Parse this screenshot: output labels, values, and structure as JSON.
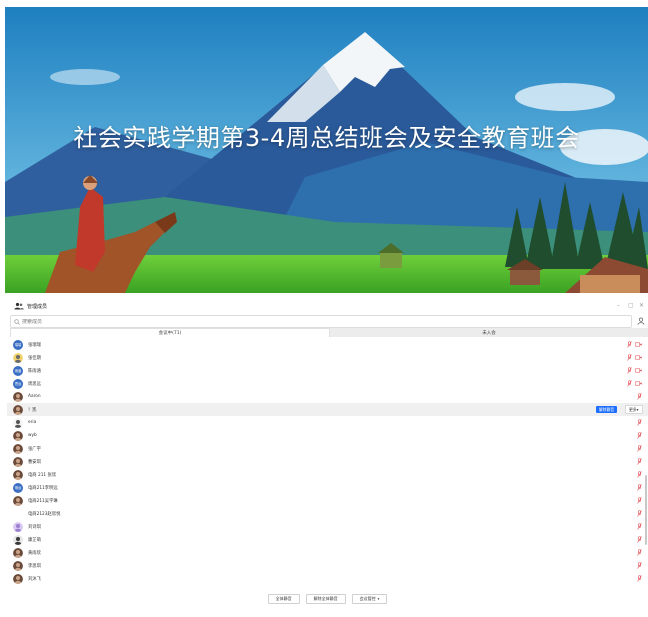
{
  "banner": {
    "title": "社会实践学期第3-4周总结班会及安全教育班会"
  },
  "window": {
    "title": "管理成员",
    "controls": [
      "–",
      "▢",
      "✕"
    ]
  },
  "search": {
    "placeholder": "搜索成员"
  },
  "tabs": [
    {
      "label": "会议中(71)",
      "active": true
    },
    {
      "label": "未入会",
      "active": false
    }
  ],
  "members": [
    {
      "name": "张瑞瑞",
      "avatar_text": "瑞瑞",
      "avatar_color": "#3a6fc4",
      "camera": true
    },
    {
      "name": "张佳期",
      "avatar_icon": "anime-avatar",
      "camera": true
    },
    {
      "name": "陈雨涵",
      "avatar_text": "雨涵",
      "avatar_color": "#3a6fc4",
      "camera": true
    },
    {
      "name": "周思远",
      "avatar_text": "思远",
      "avatar_color": "#3a6fc4",
      "camera": true
    },
    {
      "name": "Aaron",
      "avatar_icon": "photo-avatar",
      "camera": false
    },
    {
      "name": "！凯",
      "avatar_icon": "photo-avatar",
      "camera": false,
      "highlighted": true
    },
    {
      "name": "eria",
      "avatar_icon": "sketch-avatar",
      "camera": false
    },
    {
      "name": "wyb",
      "avatar_icon": "photo-avatar",
      "camera": false
    },
    {
      "name": "张广宇",
      "avatar_icon": "photo-avatar",
      "camera": false
    },
    {
      "name": "曹安琪",
      "avatar_icon": "photo-avatar",
      "camera": false
    },
    {
      "name": "电商 211 张欣",
      "avatar_icon": "photo-avatar",
      "camera": false
    },
    {
      "name": "电商211李明远",
      "avatar_text": "明远",
      "avatar_color": "#3a6fc4",
      "camera": false
    },
    {
      "name": "电商211吴宇琳",
      "avatar_icon": "photo-avatar",
      "camera": false
    },
    {
      "name": "电商2123赵欣悦",
      "avatar_icon": "none",
      "camera": false
    },
    {
      "name": "刘诗琪",
      "avatar_icon": "pastel-avatar",
      "camera": false
    },
    {
      "name": "康芷萌",
      "avatar_icon": "cartoon-avatar",
      "camera": false
    },
    {
      "name": "黄雨欣",
      "avatar_icon": "photo-avatar",
      "camera": false
    },
    {
      "name": "李思琪",
      "avatar_icon": "photo-avatar",
      "camera": false
    },
    {
      "name": "刘沐飞",
      "avatar_icon": "photo-avatar",
      "camera": false
    }
  ],
  "row_actions": {
    "unmute": "解除静音",
    "more": "更多"
  },
  "footer": {
    "mute_all": "全体静音",
    "unmute_all": "解除全体静音",
    "manage": "会议管控"
  },
  "colors": {
    "accent": "#1e6fff",
    "mic_red": "#e0404a",
    "avatar_blue": "#3a6fc4"
  }
}
